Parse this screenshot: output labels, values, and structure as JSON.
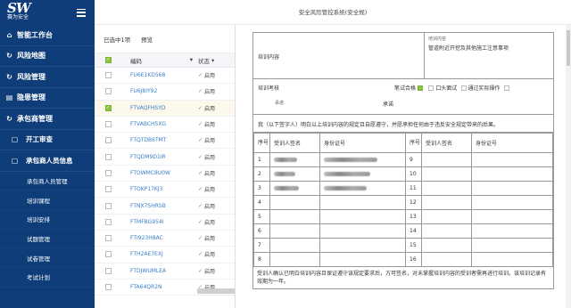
{
  "app": {
    "logo_text": "SW",
    "logo_subtitle": "赛为安全",
    "header_title": "安全风险管控系统(安全规)"
  },
  "sidebar": {
    "items": [
      {
        "label": "智能工作台",
        "icon": "home-icon"
      },
      {
        "label": "风险地图",
        "icon": "refresh-icon"
      },
      {
        "label": "风险管理",
        "icon": "refresh-icon"
      },
      {
        "label": "隐患管理",
        "icon": "document-icon"
      },
      {
        "label": "承包商管理",
        "icon": "refresh-icon"
      }
    ],
    "sub_items": [
      {
        "label": "开工审查",
        "icon": "square-icon"
      },
      {
        "label": "承包商人员信息",
        "icon": "square-icon"
      }
    ],
    "leaf_items": [
      "承包商人员管理",
      "培训课程",
      "培训安排",
      "试题管理",
      "试卷管理",
      "考试计划"
    ]
  },
  "list": {
    "selected_count_label": "已选中1项",
    "preview_label": "预览",
    "col_code": "编码",
    "col_status": "状态",
    "rows": [
      {
        "code": "FU6E1KD568",
        "status": "启用",
        "checked": false
      },
      {
        "code": "FU6J8IY92",
        "status": "启用",
        "checked": false
      },
      {
        "code": "FTVAQFHSYD",
        "status": "启用",
        "checked": true
      },
      {
        "code": "FTVABCH5XG",
        "status": "启用",
        "checked": false
      },
      {
        "code": "FTQTDB6TMT",
        "status": "启用",
        "checked": false
      },
      {
        "code": "FTQDM9D1IR",
        "status": "启用",
        "checked": false
      },
      {
        "code": "FTOWMC8U0W",
        "status": "启用",
        "checked": false
      },
      {
        "code": "FTOKP17KJ3",
        "status": "启用",
        "checked": false
      },
      {
        "code": "FTNX7SHRSB",
        "status": "启用",
        "checked": false
      },
      {
        "code": "FTMFBG954I",
        "status": "启用",
        "checked": false
      },
      {
        "code": "FTI923H8AC",
        "status": "启用",
        "checked": false
      },
      {
        "code": "FTH2AE7EXJ",
        "status": "启用",
        "checked": false
      },
      {
        "code": "FTDJWUMLEA",
        "status": "启用",
        "checked": false
      },
      {
        "code": "FTA64QR2N",
        "status": "启用",
        "checked": false
      }
    ]
  },
  "doc": {
    "training_content_label": "培训内容",
    "training_content_sublabel": "培训内容",
    "training_content_value": "管道附近开挖及其他施工注意事项",
    "assessment_label": "培训考核",
    "written_pass_label": "笔试合格",
    "oral_label": "口头面试",
    "practical_label": "通过实际操作",
    "trainer_label": "承诺",
    "trainee_label": "承诺",
    "statement": "我（以下签字人）明白以上培训内容的规定且自愿遵守，并愿承担任何由于违反安全规定带来的后果。",
    "col_no": "序号",
    "col_signer": "受训人签名",
    "col_id": "身份证号",
    "left_numbers": [
      "1",
      "2",
      "3",
      "4",
      "5",
      "6",
      "7",
      "8"
    ],
    "right_numbers": [
      "9",
      "10",
      "11",
      "12",
      "13",
      "14",
      "15",
      "16"
    ],
    "footer": "受训人确认已明白培训内容且保证遵守该规定要求后，方可签名，对未掌握培训内容的受训者需再进行培训。该培训记录有效期为一年。"
  }
}
